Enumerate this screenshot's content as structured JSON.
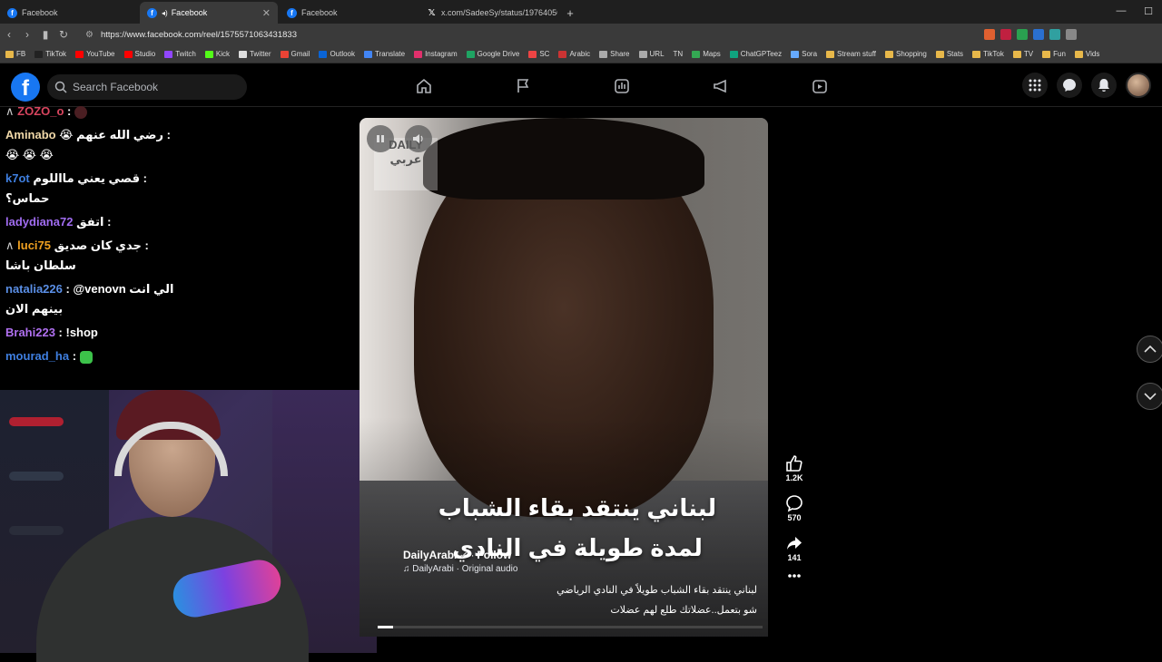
{
  "browser": {
    "tabs": [
      {
        "title": "Facebook",
        "icon": "facebook-icon",
        "active": false
      },
      {
        "title": "Facebook",
        "icon": "facebook-icon",
        "active": true
      },
      {
        "title": "Facebook",
        "icon": "facebook-icon",
        "active": false
      },
      {
        "title": "x.com/SadeeSy/status/19764056591",
        "icon": "x-icon",
        "active": false
      }
    ],
    "url": "https://www.facebook.com/reel/1575571063431833",
    "bookmarks": [
      "FB",
      "TikTok",
      "YouTube",
      "Studio",
      "Twitch",
      "Kick",
      "Twitter",
      "Gmail",
      "Outlook",
      "Translate",
      "Instagram",
      "Google Drive",
      "SC",
      "Arabic",
      "Share",
      "URL",
      "TN",
      "Maps",
      "ChatGPTeez",
      "Sora",
      "Stream stuff",
      "Shopping",
      "Stats",
      "TikTok",
      "TV",
      "Fun",
      "Vids"
    ]
  },
  "facebook": {
    "search_placeholder": "Search Facebook"
  },
  "chat": [
    {
      "user": "ZOZO_o",
      "color": "#d9455f",
      "text": ":",
      "prefix": "∧"
    },
    {
      "user": "Aminabo",
      "color": "#f0d8a8",
      "text": ": رضي الله عنهم 😭 😭 😭 😭",
      "prefix": ""
    },
    {
      "user": "k7ot",
      "color": "#3f7fe0",
      "text": ": قصي يعني مااللوم حماس؟",
      "prefix": ""
    },
    {
      "user": "ladydiana72",
      "color": "#a06cf0",
      "text": ": اتفق",
      "prefix": ""
    },
    {
      "user": "luci75",
      "color": "#f0a020",
      "text": ": جدي كان صديق سلطان باشا",
      "prefix": "∧"
    },
    {
      "user": "natalia226",
      "color": "#5a8fe6",
      "text": ": @venovn الي انت بينهم الان",
      "prefix": ""
    },
    {
      "user": "Brahi223",
      "color": "#b070f0",
      "text": ": !shop",
      "prefix": ""
    },
    {
      "user": "mourad_ha",
      "color": "#3f7fe0",
      "text": ":",
      "prefix": ""
    }
  ],
  "reel": {
    "watermark": "DAILY عربي",
    "caption_overlay": "لبناني ينتقد بقاء الشباب لمدة طويلة في النادي",
    "owner": "DailyArabi",
    "follow_label": "Follow",
    "audio": "DailyArabi · Original audio",
    "description_line1": "لبناني ينتقد بقاء الشباب طويلاً في النادي الرياضي",
    "description_line2": "شو بتعمل..عضلاتك طلع لهم عضلات",
    "progress": 0.04
  },
  "actions": {
    "likes": "1.2K",
    "comments": "570",
    "shares": "141"
  },
  "colors": {
    "facebook_blue": "#1877f2",
    "background": "#000000"
  }
}
